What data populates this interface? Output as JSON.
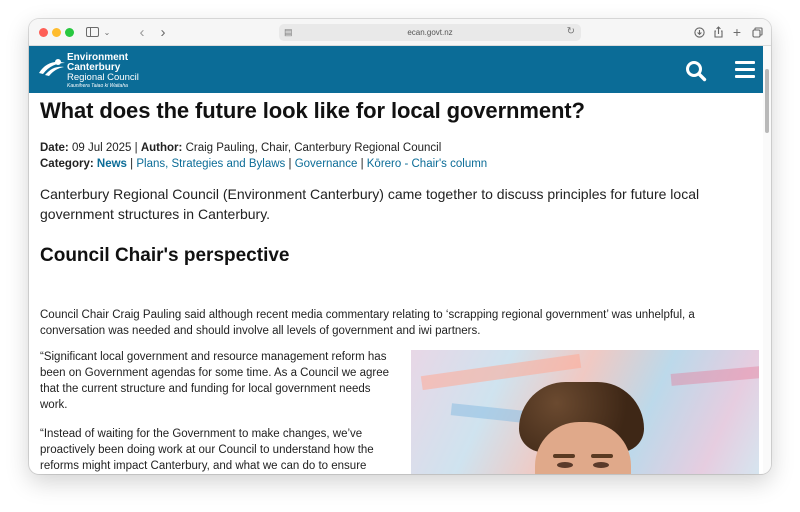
{
  "browser": {
    "url": "ecan.govt.nz"
  },
  "site": {
    "logo": {
      "line1": "Environment",
      "line2": "Canterbury",
      "line3": "Regional Council",
      "line4": "Kaunihera Taiao ki Waitaha"
    }
  },
  "article": {
    "title": "What does the future look like for local government?",
    "date_label": "Date:",
    "date_value": "09 Jul 2025",
    "sep": "|",
    "author_label": "Author:",
    "author_value": "Craig Pauling, Chair, Canterbury Regional Council",
    "category_label": "Category:",
    "categories": [
      "News",
      "Plans, Strategies and Bylaws",
      "Governance",
      "Kōrero - Chair's column"
    ],
    "intro": "Canterbury Regional Council (Environment Canterbury) came together to discuss principles for future local government structures in Canterbury.",
    "heading": "Council Chair's perspective",
    "paragraphs": [
      "Council Chair Craig Pauling said although recent media commentary relating to ‘scrapping regional government’ was unhelpful, a conversation was needed and should involve all levels of government and iwi partners.",
      "“Significant local government and resource management reform has been on Government agendas for some time. As a Council we agree that the current structure and funding for local government needs work.",
      "“Instead of waiting for the Government to make changes, we’ve proactively been doing work at our Council to understand how the reforms might impact Canterbury, and what we can do to ensure good outcomes for our natural resources, our communities as well"
    ]
  },
  "colors": {
    "brand": "#0b6c97",
    "link": "#0b6c97"
  }
}
